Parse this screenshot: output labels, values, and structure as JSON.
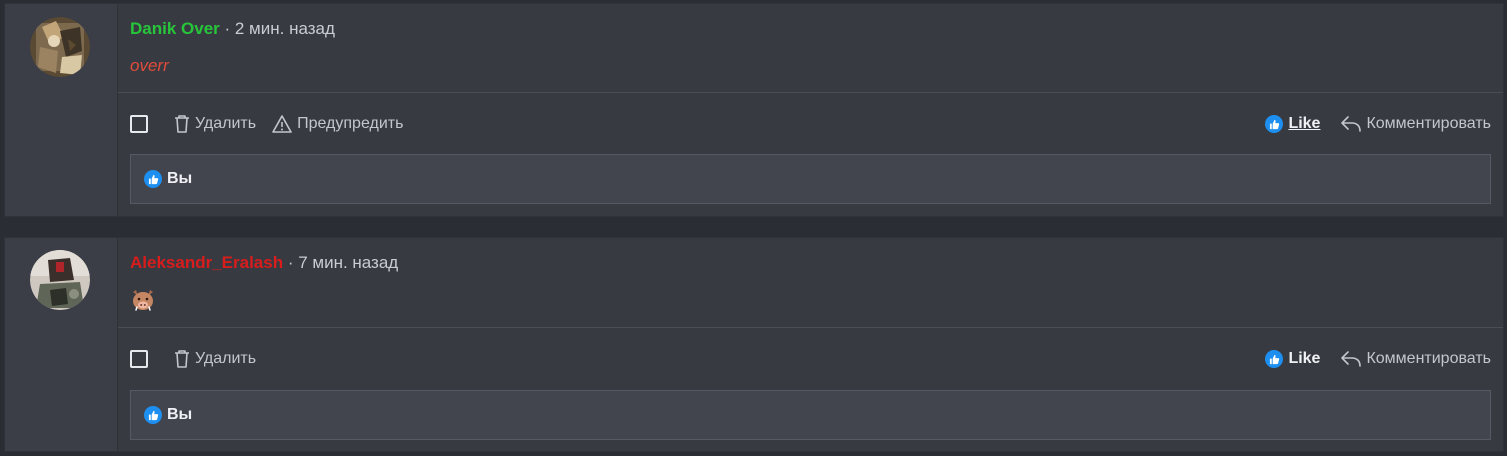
{
  "comments": [
    {
      "author": "Danik Over",
      "time": " · 2 мин. назад",
      "body": "overr",
      "actions": {
        "delete": "Удалить",
        "warn": "Предупредить",
        "like": "Like",
        "reply": "Комментировать"
      },
      "likes": "Вы"
    },
    {
      "author": "Aleksandr_Eralash",
      "time": " · 7 мин. назад",
      "body_emoji": "boar-emoji",
      "actions": {
        "delete": "Удалить",
        "like": "Like",
        "reply": "Комментировать"
      },
      "likes": "Вы"
    }
  ],
  "colors": {
    "author_1": "#27c53a",
    "author_2": "#d91c1c",
    "body_text": "#e24c3a",
    "like_badge": "#1d8ff0"
  },
  "icons": {
    "delete": "trash-icon",
    "warn": "warning-triangle-icon",
    "like": "thumbs-up-icon",
    "reply": "reply-arrow-icon"
  }
}
